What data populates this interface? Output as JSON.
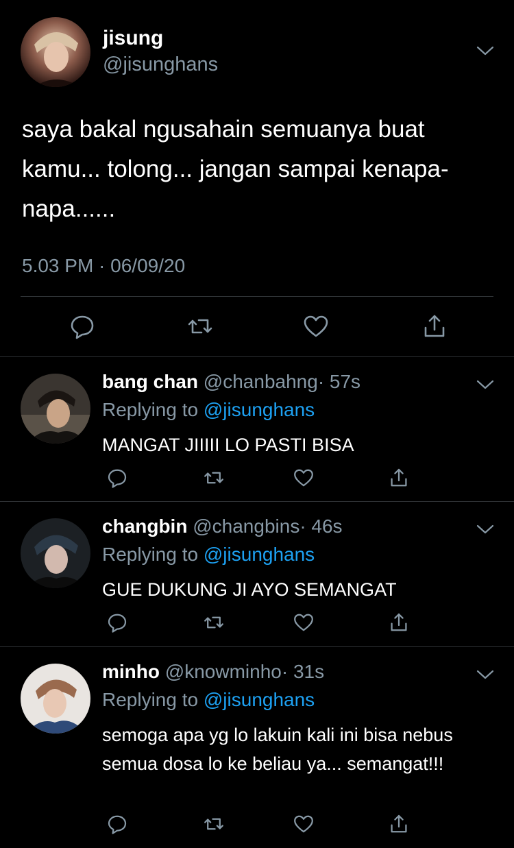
{
  "colors": {
    "background": "#000000",
    "text": "#ffffff",
    "secondary_text": "#8899a6",
    "mention": "#1da1f2",
    "divider": "#2f3336"
  },
  "main_tweet": {
    "name": "jisung",
    "handle": "@jisunghans",
    "text": "saya bakal ngusahain semuanya buat kamu... tolong... jangan sampai kenapa-napa......",
    "timestamp": "5.03 PM · 06/09/20",
    "actions": [
      "reply-icon",
      "retweet-icon",
      "like-icon",
      "share-icon"
    ]
  },
  "replies": [
    {
      "name": "bang chan",
      "handle": "@chanbahng",
      "time": "· 57s",
      "replying_prefix": "Replying to",
      "replying_to": "@jisunghans",
      "text": "MANGAT JIIIII LO PASTI BISA"
    },
    {
      "name": "changbin",
      "handle": "@changbins",
      "time": "· 46s",
      "replying_prefix": "Replying to",
      "replying_to": "@jisunghans",
      "text": "GUE DUKUNG JI AYO SEMANGAT"
    },
    {
      "name": "minho",
      "handle": "@knowminho",
      "time": "· 31s",
      "replying_prefix": "Replying to",
      "replying_to": "@jisunghans",
      "text": "semoga apa yg lo lakuin kali ini bisa nebus semua dosa lo ke beliau ya... semangat!!!"
    }
  ]
}
